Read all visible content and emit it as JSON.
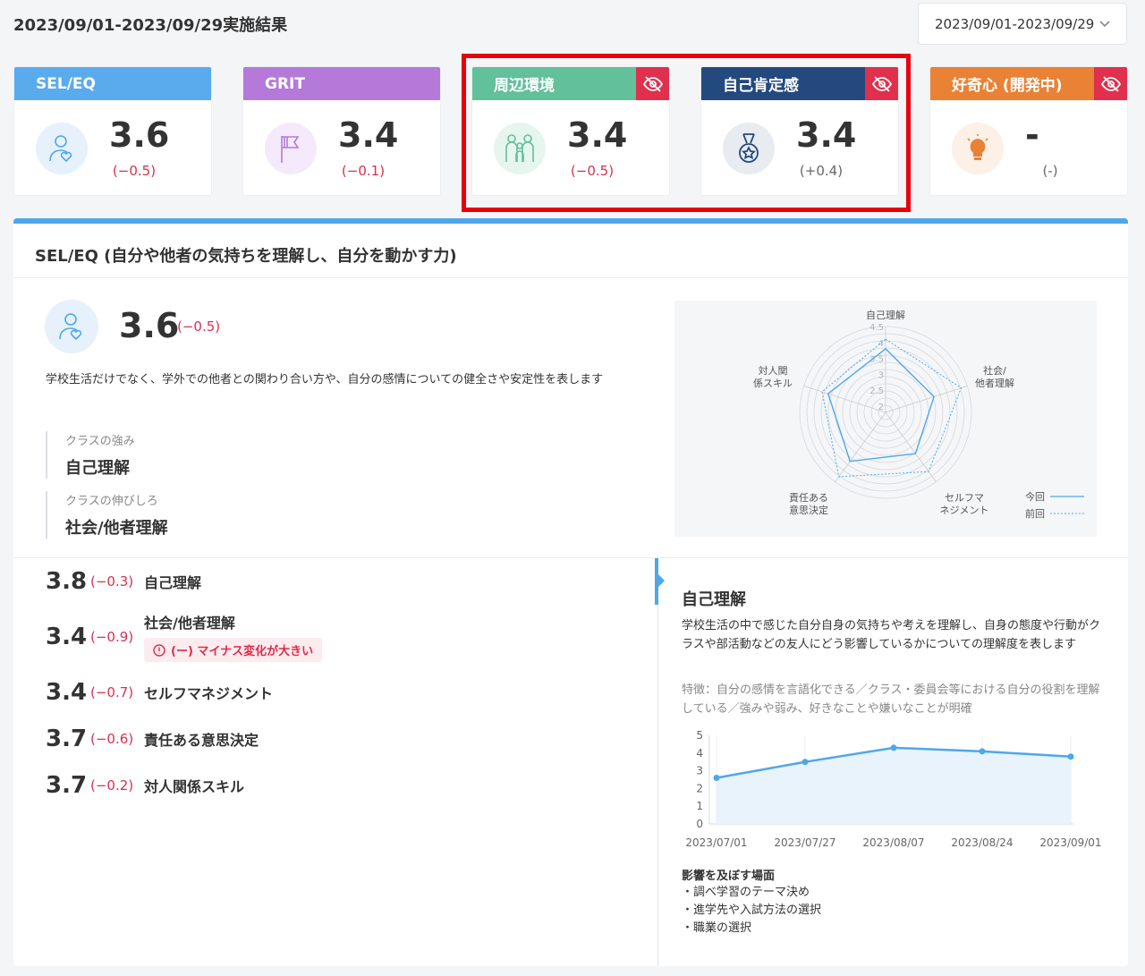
{
  "header": {
    "title": "2023/09/01-2023/09/29実施結果",
    "period_select": "2023/09/01-2023/09/29"
  },
  "cards": [
    {
      "label": "SEL/EQ",
      "score": "3.6",
      "delta": "(−0.5)",
      "color": "#5aabee",
      "hidden": false,
      "icon": "person-heart-icon"
    },
    {
      "label": "GRIT",
      "score": "3.4",
      "delta": "(−0.1)",
      "color": "#b57ad9",
      "hidden": false,
      "icon": "flag-icon"
    },
    {
      "label": "周辺環境",
      "score": "3.4",
      "delta": "(−0.5)",
      "color": "#62c09b",
      "hidden": true,
      "icon": "family-icon"
    },
    {
      "label": "自己肯定感",
      "score": "3.4",
      "delta": "(+0.4)",
      "color": "#24497e",
      "hidden": true,
      "icon": "medal-icon"
    },
    {
      "label": "好奇心 (開発中)",
      "score": "-",
      "delta": "(-)",
      "color": "#e98235",
      "hidden": true,
      "icon": "lightbulb-icon"
    }
  ],
  "panel": {
    "title": "SEL/EQ (自分や他者の気持ちを理解し、自分を動かす力)",
    "score": "3.6",
    "delta": "(−0.5)",
    "description": "学校生活だけでなく、学外での他者との関わり合い方や、自分の感情についての健全さや安定性を表します",
    "strength_label": "クラスの強み",
    "strength_value": "自己理解",
    "growth_label": "クラスの伸びしろ",
    "growth_value": "社会/他者理解"
  },
  "radar": {
    "axes": [
      "自己理解",
      "社会/\n他者理解",
      "セルフマ\nネジメント",
      "責任ある\n意思決定",
      "対人関\n係スキル"
    ],
    "ticks": [
      "4.5",
      "4",
      "3.5",
      "3",
      "2.5",
      "2"
    ],
    "legend_current": "今回",
    "legend_previous": "前回",
    "current": [
      3.8,
      3.4,
      3.4,
      3.7,
      3.7
    ],
    "previous": [
      4.1,
      4.3,
      4.1,
      4.3,
      3.9
    ]
  },
  "metrics": [
    {
      "value": "3.8",
      "delta": "(−0.3)",
      "name": "自己理解",
      "warning": ""
    },
    {
      "value": "3.4",
      "delta": "(−0.9)",
      "name": "社会/他者理解",
      "warning": "(ー) マイナス変化が大きい"
    },
    {
      "value": "3.4",
      "delta": "(−0.7)",
      "name": "セルフマネジメント",
      "warning": ""
    },
    {
      "value": "3.7",
      "delta": "(−0.6)",
      "name": "責任ある意思決定",
      "warning": ""
    },
    {
      "value": "3.7",
      "delta": "(−0.2)",
      "name": "対人関係スキル",
      "warning": ""
    }
  ],
  "detail": {
    "title": "自己理解",
    "description": "学校生活の中で感じた自分自身の気持ちや考えを理解し、自身の態度や行動がクラスや部活動などの友人にどう影響しているかについての理解度を表します",
    "features": "特徴：自分の感情を言語化できる／クラス・委員会等における自分の役割を理解している／強みや弱み、好きなことや嫌いなことが明確",
    "scene_title": "影響を及ぼす場面",
    "scenes": [
      "調べ学習のテーマ決め",
      "進学先や入試方法の選択",
      "職業の選択"
    ]
  },
  "chart_data": {
    "type": "area",
    "categories": [
      "2023/07/01",
      "2023/07/27",
      "2023/08/07",
      "2023/08/24",
      "2023/09/01"
    ],
    "values": [
      2.6,
      3.5,
      4.3,
      4.1,
      3.8
    ],
    "yticks": [
      "0",
      "1",
      "2",
      "3",
      "4",
      "5"
    ],
    "ylim": [
      0,
      5
    ]
  }
}
